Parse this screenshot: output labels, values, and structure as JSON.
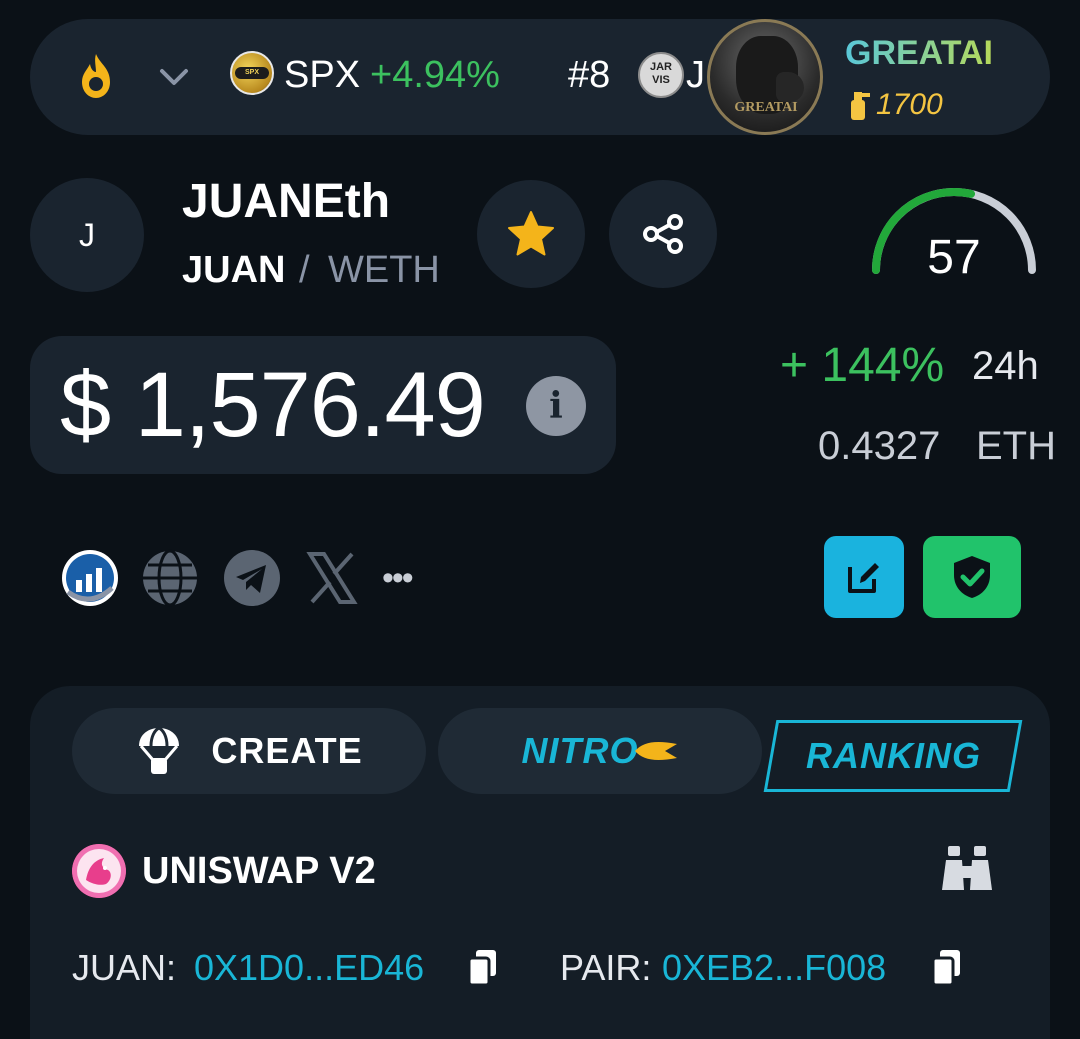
{
  "ticker": {
    "symbol": "SPX",
    "change": "+4.94%",
    "rank": "#8",
    "rank_logo_text": "JAR VIS",
    "rank_tail": "J"
  },
  "promo": {
    "name": "GREATAI",
    "score": "1700",
    "avatar_tag": "GREATAI"
  },
  "token": {
    "avatar_letter": "J",
    "name": "JUANEth",
    "base": "JUAN",
    "separator": "/",
    "quote": "WETH"
  },
  "gauge": {
    "value": "57",
    "fraction": 0.57
  },
  "price": {
    "usd": "$ 1,576.49",
    "info_glyph": "i",
    "change": "+ 144%",
    "period": "24h",
    "eth_value": "0.4327",
    "eth_unit": "ETH"
  },
  "links": {
    "icons": [
      "chart-logo-icon",
      "globe-icon",
      "telegram-icon",
      "x-icon",
      "more-icon"
    ],
    "more_glyph": "•••"
  },
  "actions": {
    "create_label": "CREATE",
    "nitro_label": "NITRO",
    "ranking_label": "RANKING"
  },
  "pair": {
    "dex": "UNISWAP V2",
    "token_label": "JUAN:",
    "token_addr": "0X1D0...ED46",
    "pair_label": "PAIR:",
    "pair_addr": "0XEB2...F008"
  },
  "colors": {
    "background": "#0b1117",
    "surface": "#1a242f",
    "positive": "#3cc15f",
    "accent": "#19b6d6",
    "star": "#f4b41a",
    "shield": "#21c36b"
  }
}
